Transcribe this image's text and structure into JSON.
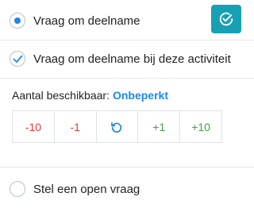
{
  "options": {
    "request_participation": {
      "label": "Vraag om deelname",
      "selected": true
    },
    "request_participation_activity": {
      "label": "Vraag om deelname bij deze activiteit",
      "checked": true
    },
    "open_question": {
      "label": "Stel een open vraag",
      "selected": false
    }
  },
  "action_button": {
    "icon": "check-circle-icon",
    "color": "#17a0b4"
  },
  "availability": {
    "label": "Aantal beschikbaar:",
    "value": "Onbeperkt"
  },
  "stepper": {
    "minus_10": "-10",
    "minus_1": "-1",
    "reset_icon": "reset-icon",
    "plus_1": "+1",
    "plus_10": "+10"
  },
  "colors": {
    "accent_blue": "#1e88e5",
    "decrement_red": "#e53935",
    "increment_green": "#43a047"
  }
}
